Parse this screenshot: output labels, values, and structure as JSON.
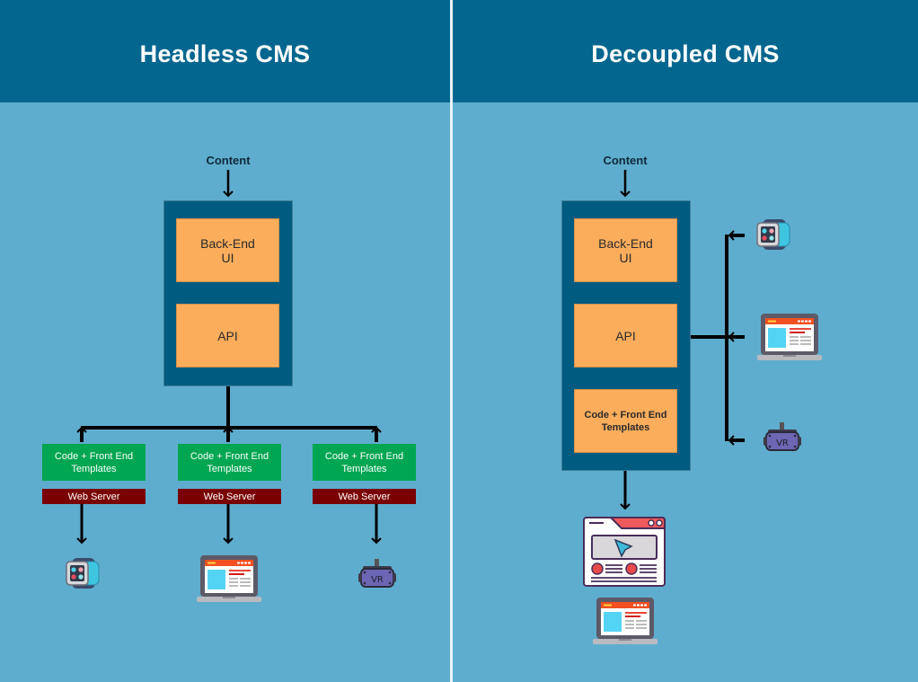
{
  "headless": {
    "title": "Headless CMS",
    "content_label": "Content",
    "cms_box": [
      "Back-End UI",
      "API"
    ],
    "backend_ui": {
      "line1": "Back-End",
      "line2": "UI"
    },
    "api": "API",
    "frontends": [
      {
        "code_line1": "Code + Front End",
        "code_line2": "Templates",
        "server": "Web Server",
        "device": "smartwatch"
      },
      {
        "code_line1": "Code + Front End",
        "code_line2": "Templates",
        "server": "Web Server",
        "device": "laptop"
      },
      {
        "code_line1": "Code + Front End",
        "code_line2": "Templates",
        "server": "Web Server",
        "device": "vr-headset"
      }
    ]
  },
  "decoupled": {
    "title": "Decoupled CMS",
    "content_label": "Content",
    "backend_ui": {
      "line1": "Back-End",
      "line2": "UI"
    },
    "api": "API",
    "templates": {
      "line1": "Code + Front End",
      "line2": "Templates"
    },
    "api_devices": [
      "smartwatch",
      "laptop",
      "vr-headset"
    ],
    "output_devices": [
      "web-page",
      "laptop"
    ]
  },
  "colors": {
    "header": "#02668f",
    "background": "#5fadce",
    "cms_container": "#005b80",
    "component": "#fbad5c",
    "code_box": "#00a651",
    "web_server": "#7a0000",
    "arrow": "#000000"
  },
  "vr_label": "VR"
}
